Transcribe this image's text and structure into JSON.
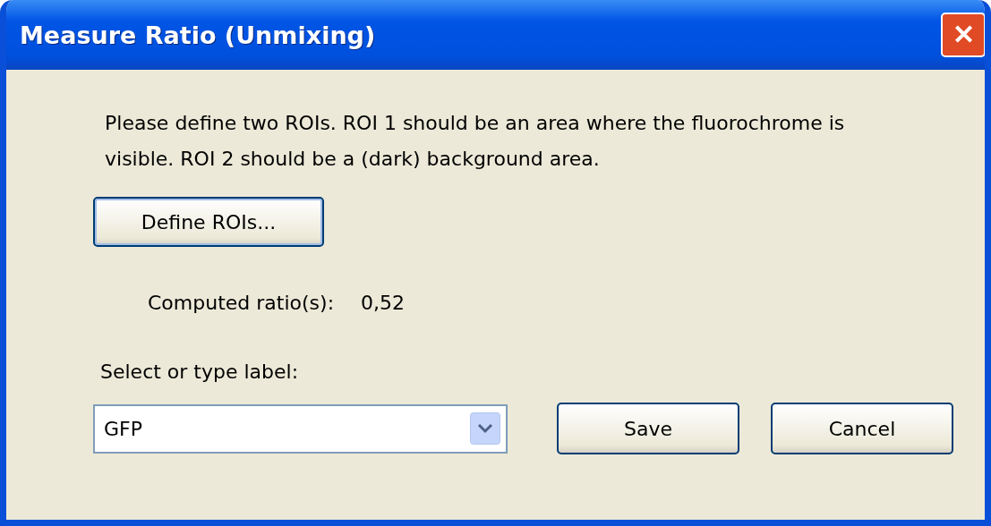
{
  "window": {
    "title": "Measure Ratio (Unmixing)",
    "close": "✕"
  },
  "instructions": "Please define two ROIs. ROI 1 should be an area where the fluorochrome is visible. ROI 2 should be a (dark) background area.",
  "define_button": "Define ROIs...",
  "ratio": {
    "label": "Computed ratio(s):",
    "value": "0,52"
  },
  "label_select": {
    "label": "Select or type label:",
    "value": "GFP"
  },
  "buttons": [
    "Save",
    "Cancel"
  ]
}
